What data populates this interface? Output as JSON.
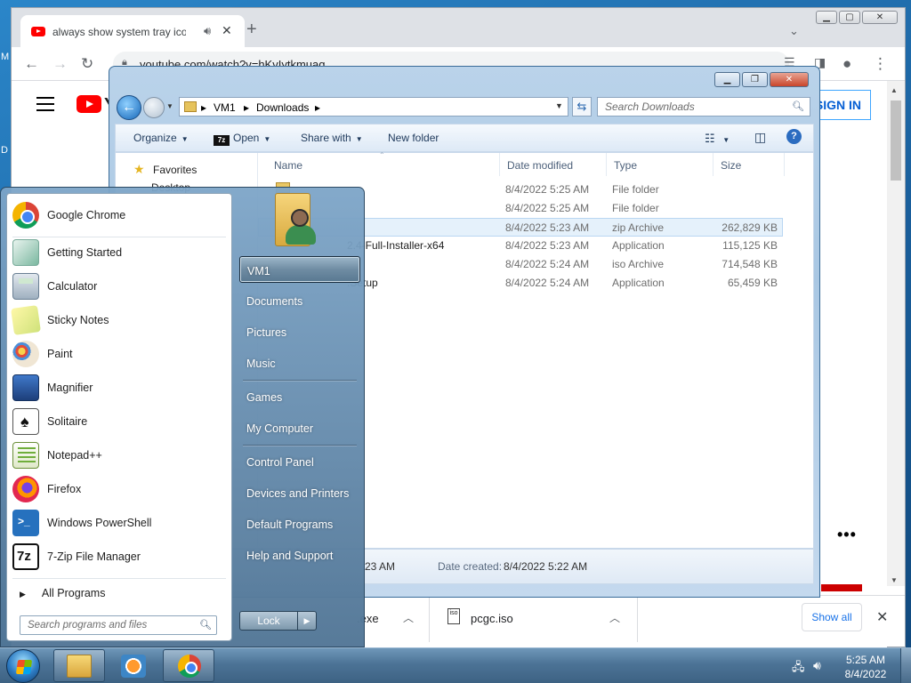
{
  "desktop": {
    "left_letters": [
      "M",
      "D"
    ]
  },
  "chrome": {
    "tab_title": "always show system tray icon",
    "address": "youtube.com/watch?v=hKvIytkmuaq",
    "page": {
      "logo_letter": "Y",
      "signin": "SIGN IN",
      "more": "•••"
    },
    "window_buttons": [
      "▁",
      "▢",
      "✕"
    ],
    "downloads": [
      {
        "name": ".exe"
      },
      {
        "name": "pcgc.iso"
      }
    ],
    "show_all": "Show all"
  },
  "explorer": {
    "breadcrumb": [
      "VM1",
      "Downloads"
    ],
    "search_placeholder": "Search Downloads",
    "toolbar": {
      "organize": "Organize",
      "open": "Open",
      "share": "Share with",
      "new_folder": "New folder"
    },
    "nav": {
      "favorites": "Favorites",
      "desktop": "Desktop"
    },
    "columns": {
      "name": "Name",
      "date": "Date modified",
      "type": "Type",
      "size": "Size"
    },
    "rows": [
      {
        "name": "",
        "date": "8/4/2022 5:25 AM",
        "type": "File folder",
        "size": ""
      },
      {
        "name": "",
        "date": "8/4/2022 5:25 AM",
        "type": "File folder",
        "size": ""
      },
      {
        "name": "",
        "date": "8/4/2022 5:23 AM",
        "type": "zip Archive",
        "size": "262,829 KB"
      },
      {
        "name": "2.4-Full-Installer-x64",
        "date": "8/4/2022 5:23 AM",
        "type": "Application",
        "size": "115,125 KB"
      },
      {
        "name": "",
        "date": "8/4/2022 5:24 AM",
        "type": "iso Archive",
        "size": "714,548 KB"
      },
      {
        "name": ".Setup",
        "date": "8/4/2022 5:24 AM",
        "type": "Application",
        "size": "65,459 KB"
      }
    ],
    "details": {
      "modified": "23 AM",
      "created_label": "Date created:",
      "created_value": "8/4/2022 5:22 AM"
    }
  },
  "startmenu": {
    "pinned": [
      "Google Chrome"
    ],
    "programs": [
      "Getting Started",
      "Calculator",
      "Sticky Notes",
      "Paint",
      "Magnifier",
      "Solitaire",
      "Notepad++",
      "Firefox",
      "Windows PowerShell",
      "7-Zip File Manager"
    ],
    "all_programs": "All Programs",
    "search_placeholder": "Search programs and files",
    "right": {
      "user": "VM1",
      "documents": "Documents",
      "pictures": "Pictures",
      "music": "Music",
      "games": "Games",
      "computer": "My Computer",
      "control_panel": "Control Panel",
      "devices": "Devices and Printers",
      "defaults": "Default Programs",
      "help": "Help and Support"
    },
    "lock": "Lock"
  },
  "taskbar": {
    "time": "5:25 AM",
    "date": "8/4/2022"
  }
}
